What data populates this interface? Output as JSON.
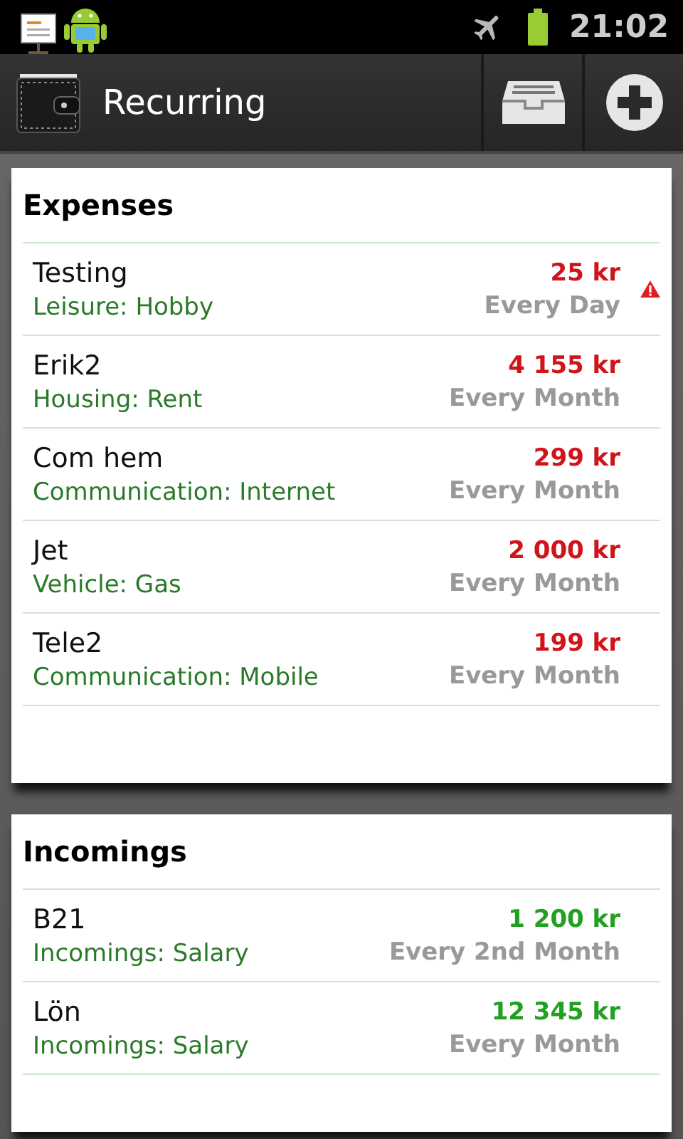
{
  "status_bar": {
    "time": "21:02"
  },
  "action_bar": {
    "title": "Recurring"
  },
  "sections": [
    {
      "title": "Expenses",
      "kind": "expense",
      "items": [
        {
          "name": "Testing",
          "category": "Leisure: Hobby",
          "amount": "25 kr",
          "frequency": "Every Day",
          "warning": true
        },
        {
          "name": "Erik2",
          "category": "Housing: Rent",
          "amount": "4 155 kr",
          "frequency": "Every Month",
          "warning": false
        },
        {
          "name": "Com hem",
          "category": "Communication: Internet",
          "amount": "299 kr",
          "frequency": "Every Month",
          "warning": false
        },
        {
          "name": "Jet",
          "category": "Vehicle: Gas",
          "amount": "2 000 kr",
          "frequency": "Every Month",
          "warning": false
        },
        {
          "name": "Tele2",
          "category": "Communication: Mobile",
          "amount": "199 kr",
          "frequency": "Every Month",
          "warning": false
        }
      ]
    },
    {
      "title": "Incomings",
      "kind": "income",
      "items": [
        {
          "name": "B21",
          "category": "Incomings: Salary",
          "amount": "1 200 kr",
          "frequency": "Every 2nd Month",
          "warning": false
        },
        {
          "name": "Lön",
          "category": "Incomings: Salary",
          "amount": "12 345 kr",
          "frequency": "Every Month",
          "warning": false
        }
      ]
    }
  ]
}
